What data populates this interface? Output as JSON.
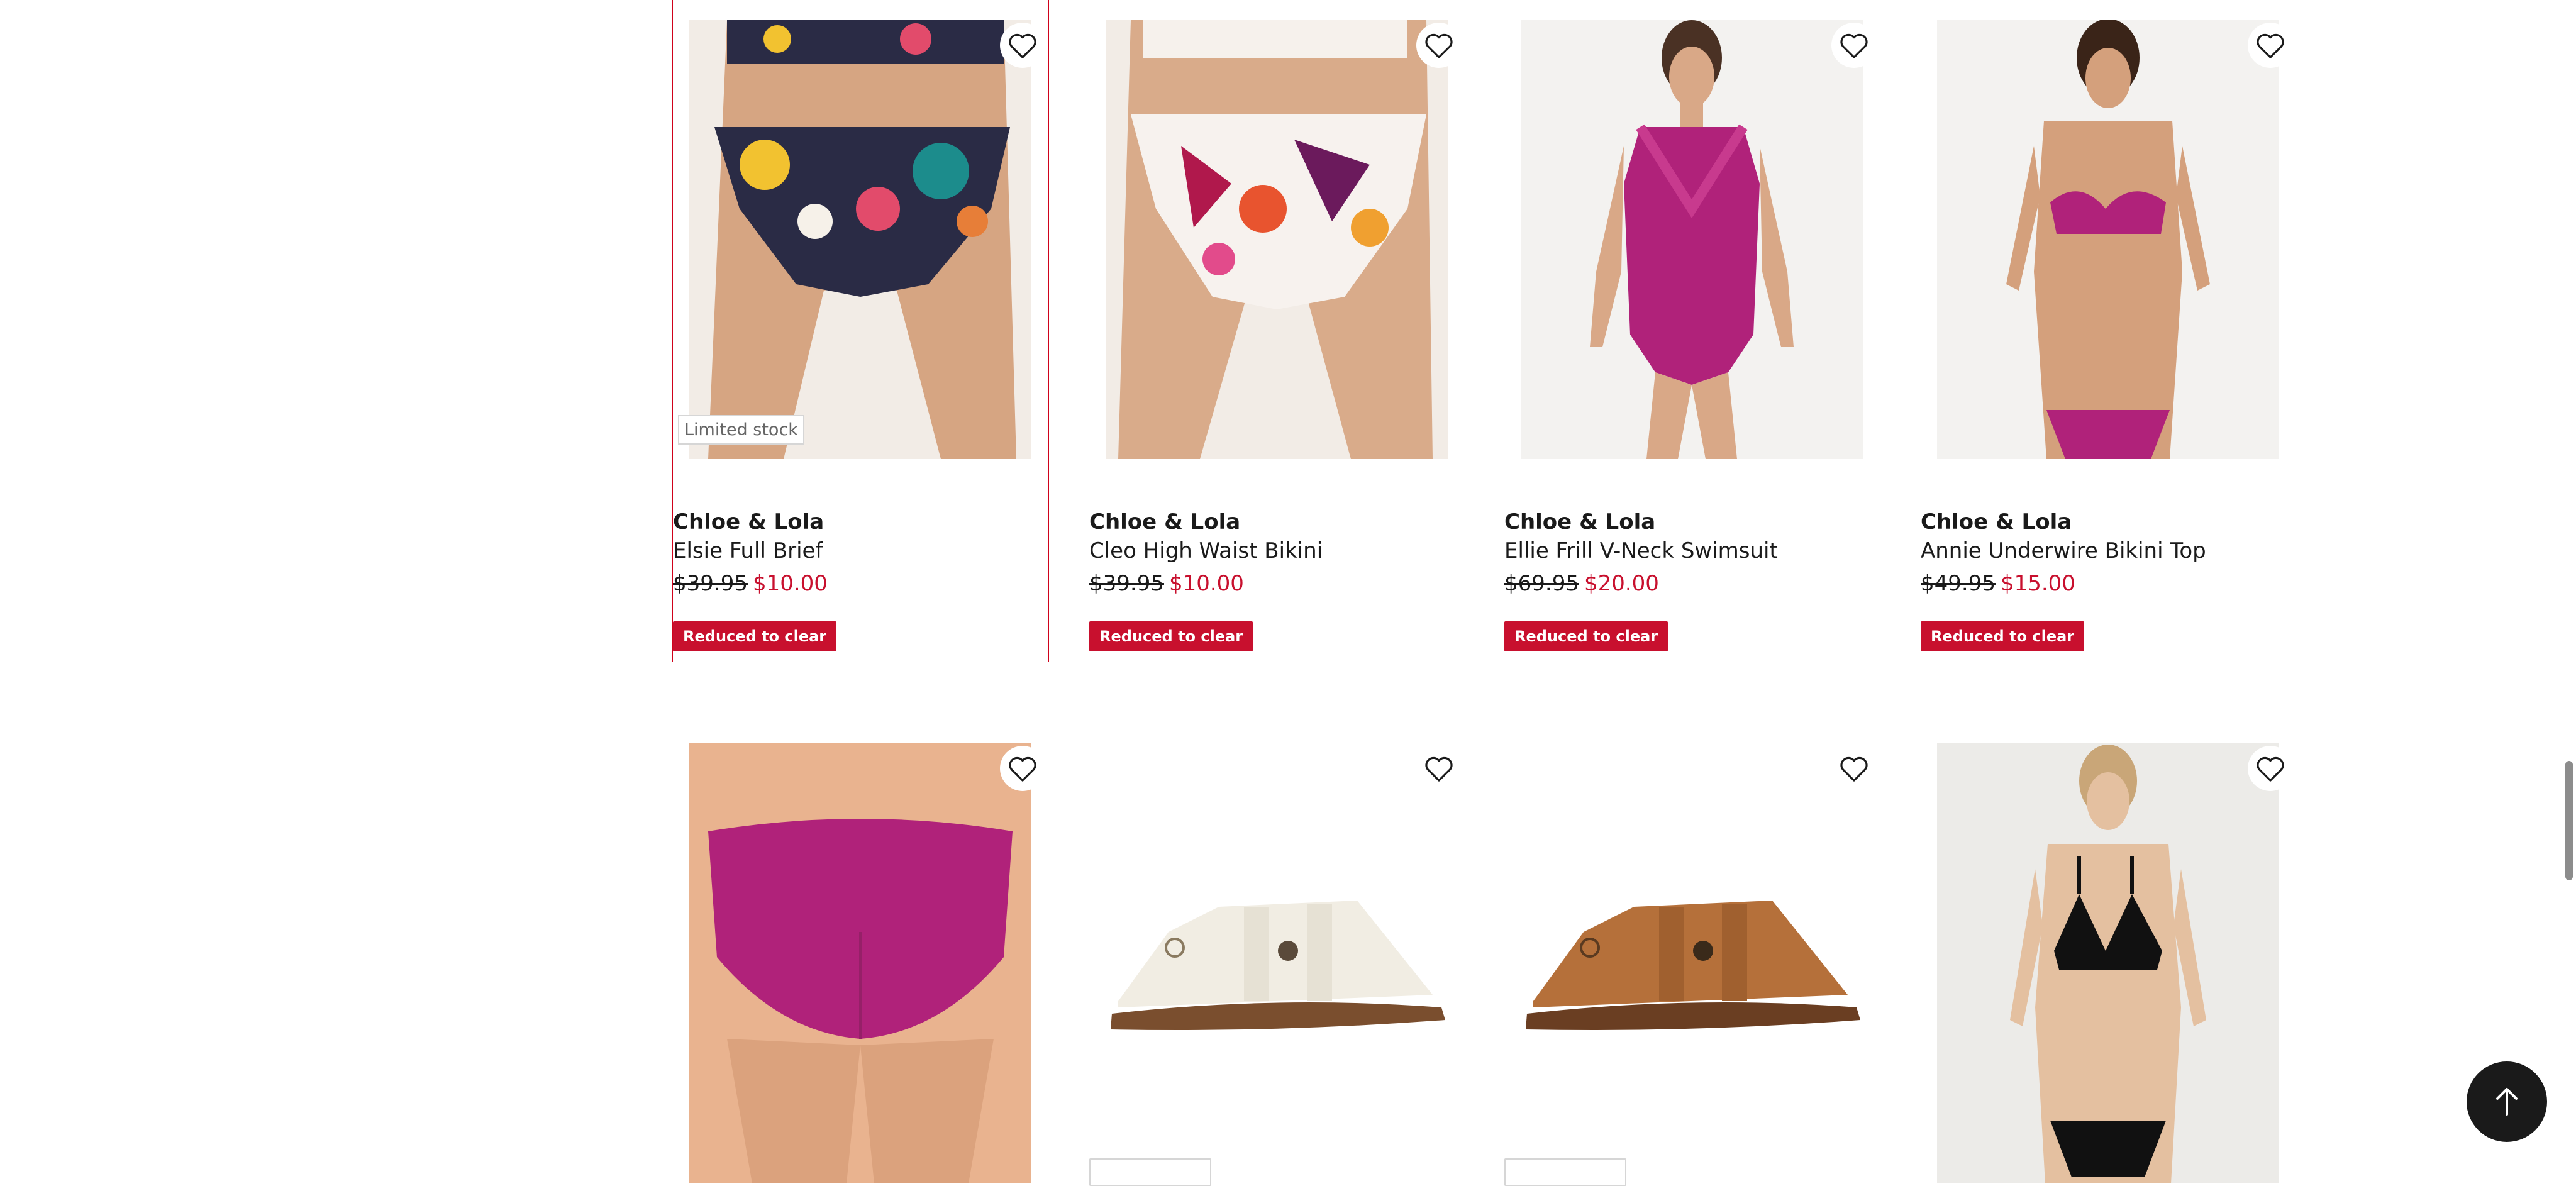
{
  "colors": {
    "sale_red": "#c8102e",
    "selection_outline": "#d0021b",
    "heart_stroke": "#1a1a1a"
  },
  "icons": {
    "wishlist": "heart-outline-icon",
    "back_to_top": "arrow-up-icon"
  },
  "products": [
    {
      "brand": "Chloe & Lola",
      "name": "Elsie Full Brief",
      "was_price": "$39.95",
      "now_price": "$10.00",
      "tag": "Reduced to clear",
      "stock_badge": "Limited stock",
      "image": "printed high-waist bikini brief"
    },
    {
      "brand": "Chloe & Lola",
      "name": "Cleo High Waist Bikini",
      "was_price": "$39.95",
      "now_price": "$10.00",
      "tag": "Reduced to clear",
      "image": "white floral high-waist bikini"
    },
    {
      "brand": "Chloe & Lola",
      "name": "Ellie Frill V-Neck Swimsuit",
      "was_price": "$69.95",
      "now_price": "$20.00",
      "tag": "Reduced to clear",
      "image": "magenta frill one-piece swimsuit"
    },
    {
      "brand": "Chloe & Lola",
      "name": "Annie Underwire Bikini Top",
      "was_price": "$49.95",
      "now_price": "$15.00",
      "tag": "Reduced to clear",
      "image": "magenta underwire bikini"
    }
  ],
  "products_row2": [
    {
      "image": "magenta bikini brief back view"
    },
    {
      "image": "white leather slingback sandal"
    },
    {
      "image": "tan leather slingback sandal"
    },
    {
      "image": "black triangle bikini"
    }
  ]
}
